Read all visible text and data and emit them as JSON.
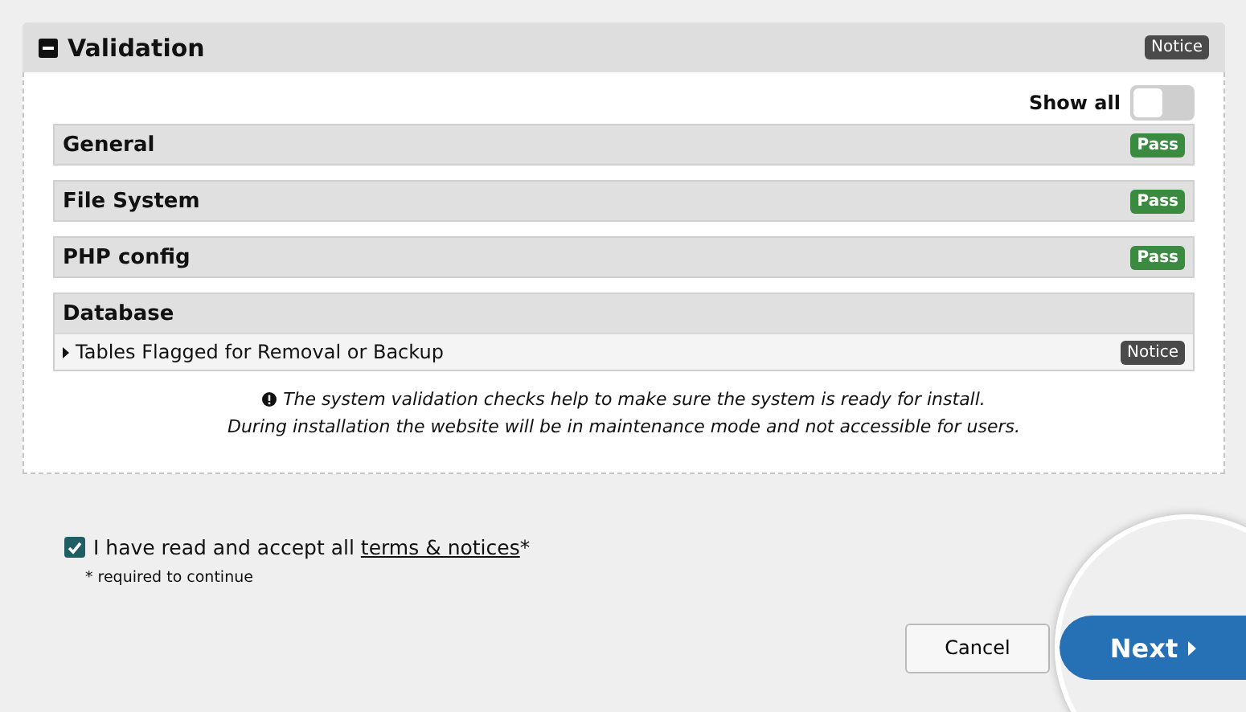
{
  "panel": {
    "title": "Validation",
    "expanded": true,
    "status": {
      "kind": "notice",
      "label": "Notice"
    }
  },
  "show_all": {
    "label": "Show all",
    "on": false
  },
  "sections": [
    {
      "title": "General",
      "status": {
        "kind": "pass",
        "label": "Pass"
      }
    },
    {
      "title": "File System",
      "status": {
        "kind": "pass",
        "label": "Pass"
      }
    },
    {
      "title": "PHP config",
      "status": {
        "kind": "pass",
        "label": "Pass"
      }
    },
    {
      "title": "Database",
      "items": [
        {
          "label": "Tables Flagged for Removal or Backup",
          "expanded": false,
          "status": {
            "kind": "notice",
            "label": "Notice"
          }
        }
      ]
    }
  ],
  "info": [
    "The system validation checks help to make sure the system is ready for install.",
    "During installation the website will be in maintenance mode and not accessible for users."
  ],
  "accept": {
    "checked": true,
    "text": "I have read and accept all",
    "link": "terms & notices",
    "mark": "*",
    "note": "* required to continue"
  },
  "buttons": {
    "cancel": "Cancel",
    "next": "Next"
  }
}
